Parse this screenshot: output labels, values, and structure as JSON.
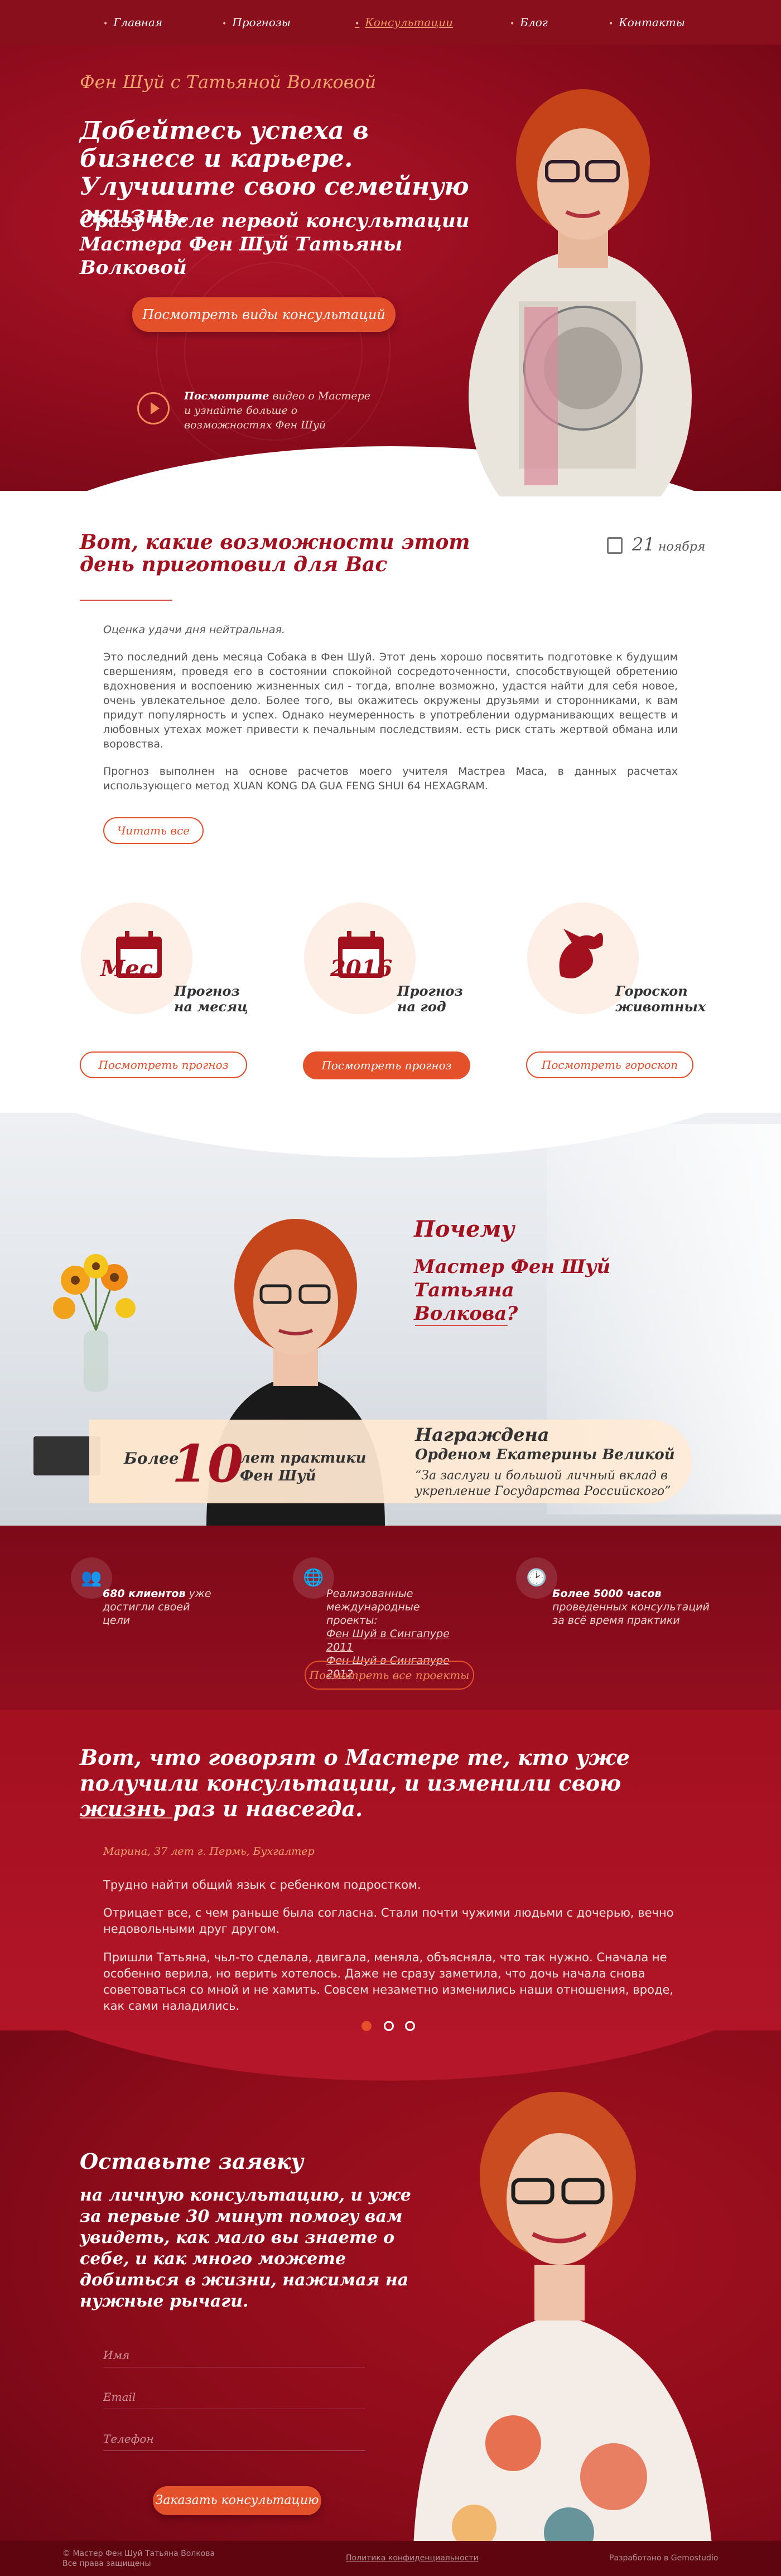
{
  "nav": {
    "items": [
      {
        "label": "Главная"
      },
      {
        "label": "Прогнозы"
      },
      {
        "label": "Консультации"
      },
      {
        "label": "Блог"
      },
      {
        "label": "Контакты"
      }
    ]
  },
  "hero": {
    "subtitle": "Фен Шуй с Татьяной Волковой",
    "title": "Добейтесь успеха в бизнесе и карьере. Улучшите свою семейную жизнь.",
    "title2": "Сразу после первой консультации Мастера Фен Шуй Татьяны Волковой",
    "button": "Посмотреть виды консультаций",
    "video_bold": "Посмотрите",
    "video_text": "видео о Мастере и узнайте больше о возможностях Фен Шуй"
  },
  "forecast": {
    "title": "Вот, какие возможности этот день приготовил для Вас",
    "date_day": "21",
    "date_month": "ноября",
    "rating": "Оценка удачи дня нейтральная.",
    "text1": "Это последний день месяца Собака в Фен Шуй. Этот день хорошо посвятить подготовке к будущим свершениям, проведя его в состоянии спокойной сосредоточенности, способствующей обретению вдохновения и воспоению жизненных сил - тогда, вполне возможно, удастся найти для себя новое, очень увлекательное дело. Более того, вы окажитесь окружены друзьями и сторонниками, к вам придут популярность и успех. Однако неумеренность в употреблении одурманивающих веществ и любовных утехах может привести к печальным последствиям. есть риск стать жертвой обмана или воровства.",
    "text2": "Прогноз выполнен на основе расчетов моего учителя Мастреа Маса, в данных расчетах использующего метод XUAN KONG DA GUA FENG SHUI 64 HEXAGRAM.",
    "read_all": "Читать все",
    "cards": [
      {
        "icon_text": "Мес.",
        "label1": "Прогноз",
        "label2": "на месяц",
        "button": "Посмотреть прогноз"
      },
      {
        "icon_text": "2016",
        "label1": "Прогноз",
        "label2": "на год",
        "button": "Посмотреть прогноз"
      },
      {
        "icon_text": "",
        "label1": "Гороскоп",
        "label2": "животных",
        "button": "Посмотреть гороскоп"
      }
    ]
  },
  "why": {
    "title": "Почему",
    "subtitle": "Мастер Фен Шуй Татьяна Волкова?",
    "exp_pre": "Более",
    "exp_num": "10",
    "exp_post1": "лет практики",
    "exp_post2": "Фен Шуй",
    "award_h": "Награждена",
    "award_s": "Орденом Екатерины Великой",
    "award_q": "“За заслуги и большой личный вклад в укрепление Государства Российского”"
  },
  "stats": {
    "s1_bold": "680 клиентов",
    "s1_text": "уже достигли своей цели",
    "s2_text": "Реализованные международные проекты:",
    "s2_link1": "Фен Шуй в Сингапуре 2011",
    "s2_link2": "Фен Шуй в Сингапуре 2012",
    "s3_bold": "Более 5000 часов",
    "s3_text": "проведенных консультаций за всё время практики",
    "button": "Посмотреть все проекты"
  },
  "testimonials": {
    "title": "Вот, что говорят о Мастере те, кто уже получили консультации, и изменили свою жизнь раз и навсегда.",
    "author": "Марина, 37 лет г. Пермь, Бухгалтер",
    "p1": "Трудно найти общий язык с ребенком подростком.",
    "p2": "Отрицает все, с чем раньше была согласна. Стали почти чужими людьми с дочерью, вечно недовольными друг другом.",
    "p3": "Пришли Татьяна, чьл-то сделала, двигала, меняла, объясняла, что так нужно. Сначала не особенно верила, но верить хотелось. Даже не сразу заметила, что дочь начала снова советоваться со мной и не хамить. Совсем незаметно изменились наши отношения, вроде, как сами наладились."
  },
  "form": {
    "title": "Оставьте заявку",
    "subtitle": "на личную консультацию, и уже за первые 30 минут помогу вам увидеть, как мало вы знаете о себе, и как много можете добиться в жизни, нажимая на нужные рычаги.",
    "name_ph": "Имя",
    "email_ph": "Email",
    "phone_ph": "Телефон",
    "button": "Заказать консультацию"
  },
  "footer": {
    "copy1": "© Мастер Фен Шуй Татьяна Волкова",
    "copy2": "Все права защищены",
    "privacy": "Политика конфиденциальности",
    "dev": "Разработано в Gemostudio"
  },
  "colors": {
    "primary": "#8a0f1c",
    "accent": "#e4502a",
    "heading": "#a3111f"
  }
}
